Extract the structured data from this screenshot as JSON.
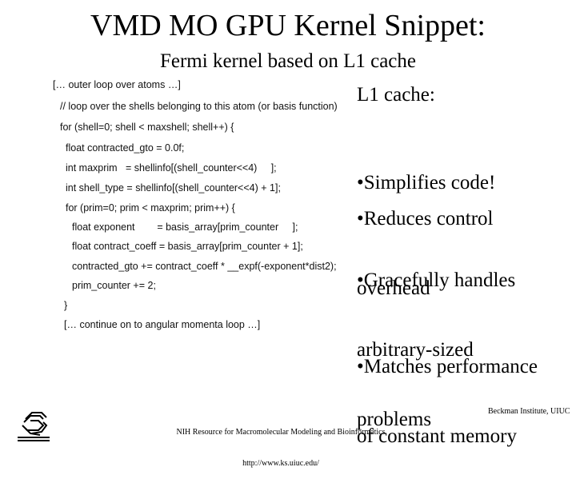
{
  "slide": {
    "title": "VMD MO GPU Kernel Snippet:",
    "subtitle": "Fermi kernel based on L1 cache"
  },
  "code": {
    "lines": [
      "[… outer loop over atoms …]",
      "// loop over the shells belonging to this atom (or basis function)",
      "for (shell=0; shell < maxshell; shell++) {",
      "float contracted_gto = 0.0f;",
      "int maxprim   = shellinfo[(shell_counter<<4)     ];",
      "int shell_type = shellinfo[(shell_counter<<4) + 1];",
      "for (prim=0; prim < maxprim; prim++) {",
      "float exponent        = basis_array[prim_counter     ];",
      "float contract_coeff = basis_array[prim_counter + 1];",
      "contracted_gto += contract_coeff * __expf(-exponent*dist2);",
      "prim_counter += 2;",
      "}",
      "[… continue on to angular momenta loop …]"
    ]
  },
  "sidebar": {
    "heading": "L1 cache:",
    "bullets": [
      {
        "line1": "•Simplifies code!",
        "line2": ""
      },
      {
        "line1": "•Reduces control",
        "line2": "overhead"
      },
      {
        "line1": "•Gracefully handles",
        "line2": "arbitrary-sized",
        "line3": "problems"
      },
      {
        "line1": "•Matches performance",
        "line2": "of constant memory"
      }
    ]
  },
  "footer": {
    "logo_icon": "beckman-institute-logo",
    "center_line1": "NIH Resource for Macromolecular Modeling and Bioinformatics",
    "center_line2": "http://www.ks.uiuc.edu/",
    "right": "Beckman Institute, UIUC"
  }
}
